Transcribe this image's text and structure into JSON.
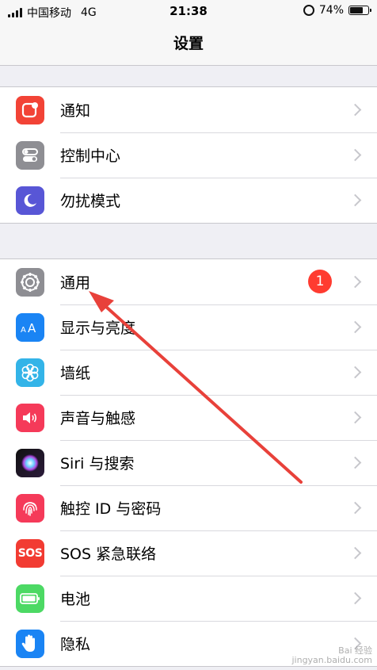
{
  "status": {
    "carrier": "中国移动",
    "network": "4G",
    "time": "21:38",
    "battery_percent": "74%",
    "battery_level": 0.74
  },
  "nav": {
    "title": "设置"
  },
  "groups": [
    {
      "items": [
        {
          "label": "通知",
          "icon": "notifications-icon",
          "color": "#f24336"
        },
        {
          "label": "控制中心",
          "icon": "control-center-icon",
          "color": "#8e8e93"
        },
        {
          "label": "勿扰模式",
          "icon": "moon-icon",
          "color": "#5856d6"
        }
      ]
    },
    {
      "items": [
        {
          "label": "通用",
          "icon": "gear-icon",
          "color": "#8e8e93",
          "badge": "1"
        },
        {
          "label": "显示与亮度",
          "icon": "display-brightness-icon",
          "color": "#1a84f4"
        },
        {
          "label": "墙纸",
          "icon": "wallpaper-icon",
          "color": "#33b4e8"
        },
        {
          "label": "声音与触感",
          "icon": "speaker-icon",
          "color": "#f53a59"
        },
        {
          "label": "Siri 与搜索",
          "icon": "siri-icon",
          "color": "#111111"
        },
        {
          "label": "触控 ID 与密码",
          "icon": "fingerprint-icon",
          "color": "#f53a59"
        },
        {
          "label": "SOS 紧急联络",
          "icon": "sos-icon",
          "color": "#f23b32",
          "icon_text": "SOS"
        },
        {
          "label": "电池",
          "icon": "battery-icon",
          "color": "#4cd964"
        },
        {
          "label": "隐私",
          "icon": "hand-icon",
          "color": "#1a84f4"
        }
      ]
    }
  ],
  "annotation": {
    "arrow_color": "#e8413a"
  },
  "watermark": {
    "line1": "Bai 经验",
    "line2": "jingyan.baidu.com"
  }
}
